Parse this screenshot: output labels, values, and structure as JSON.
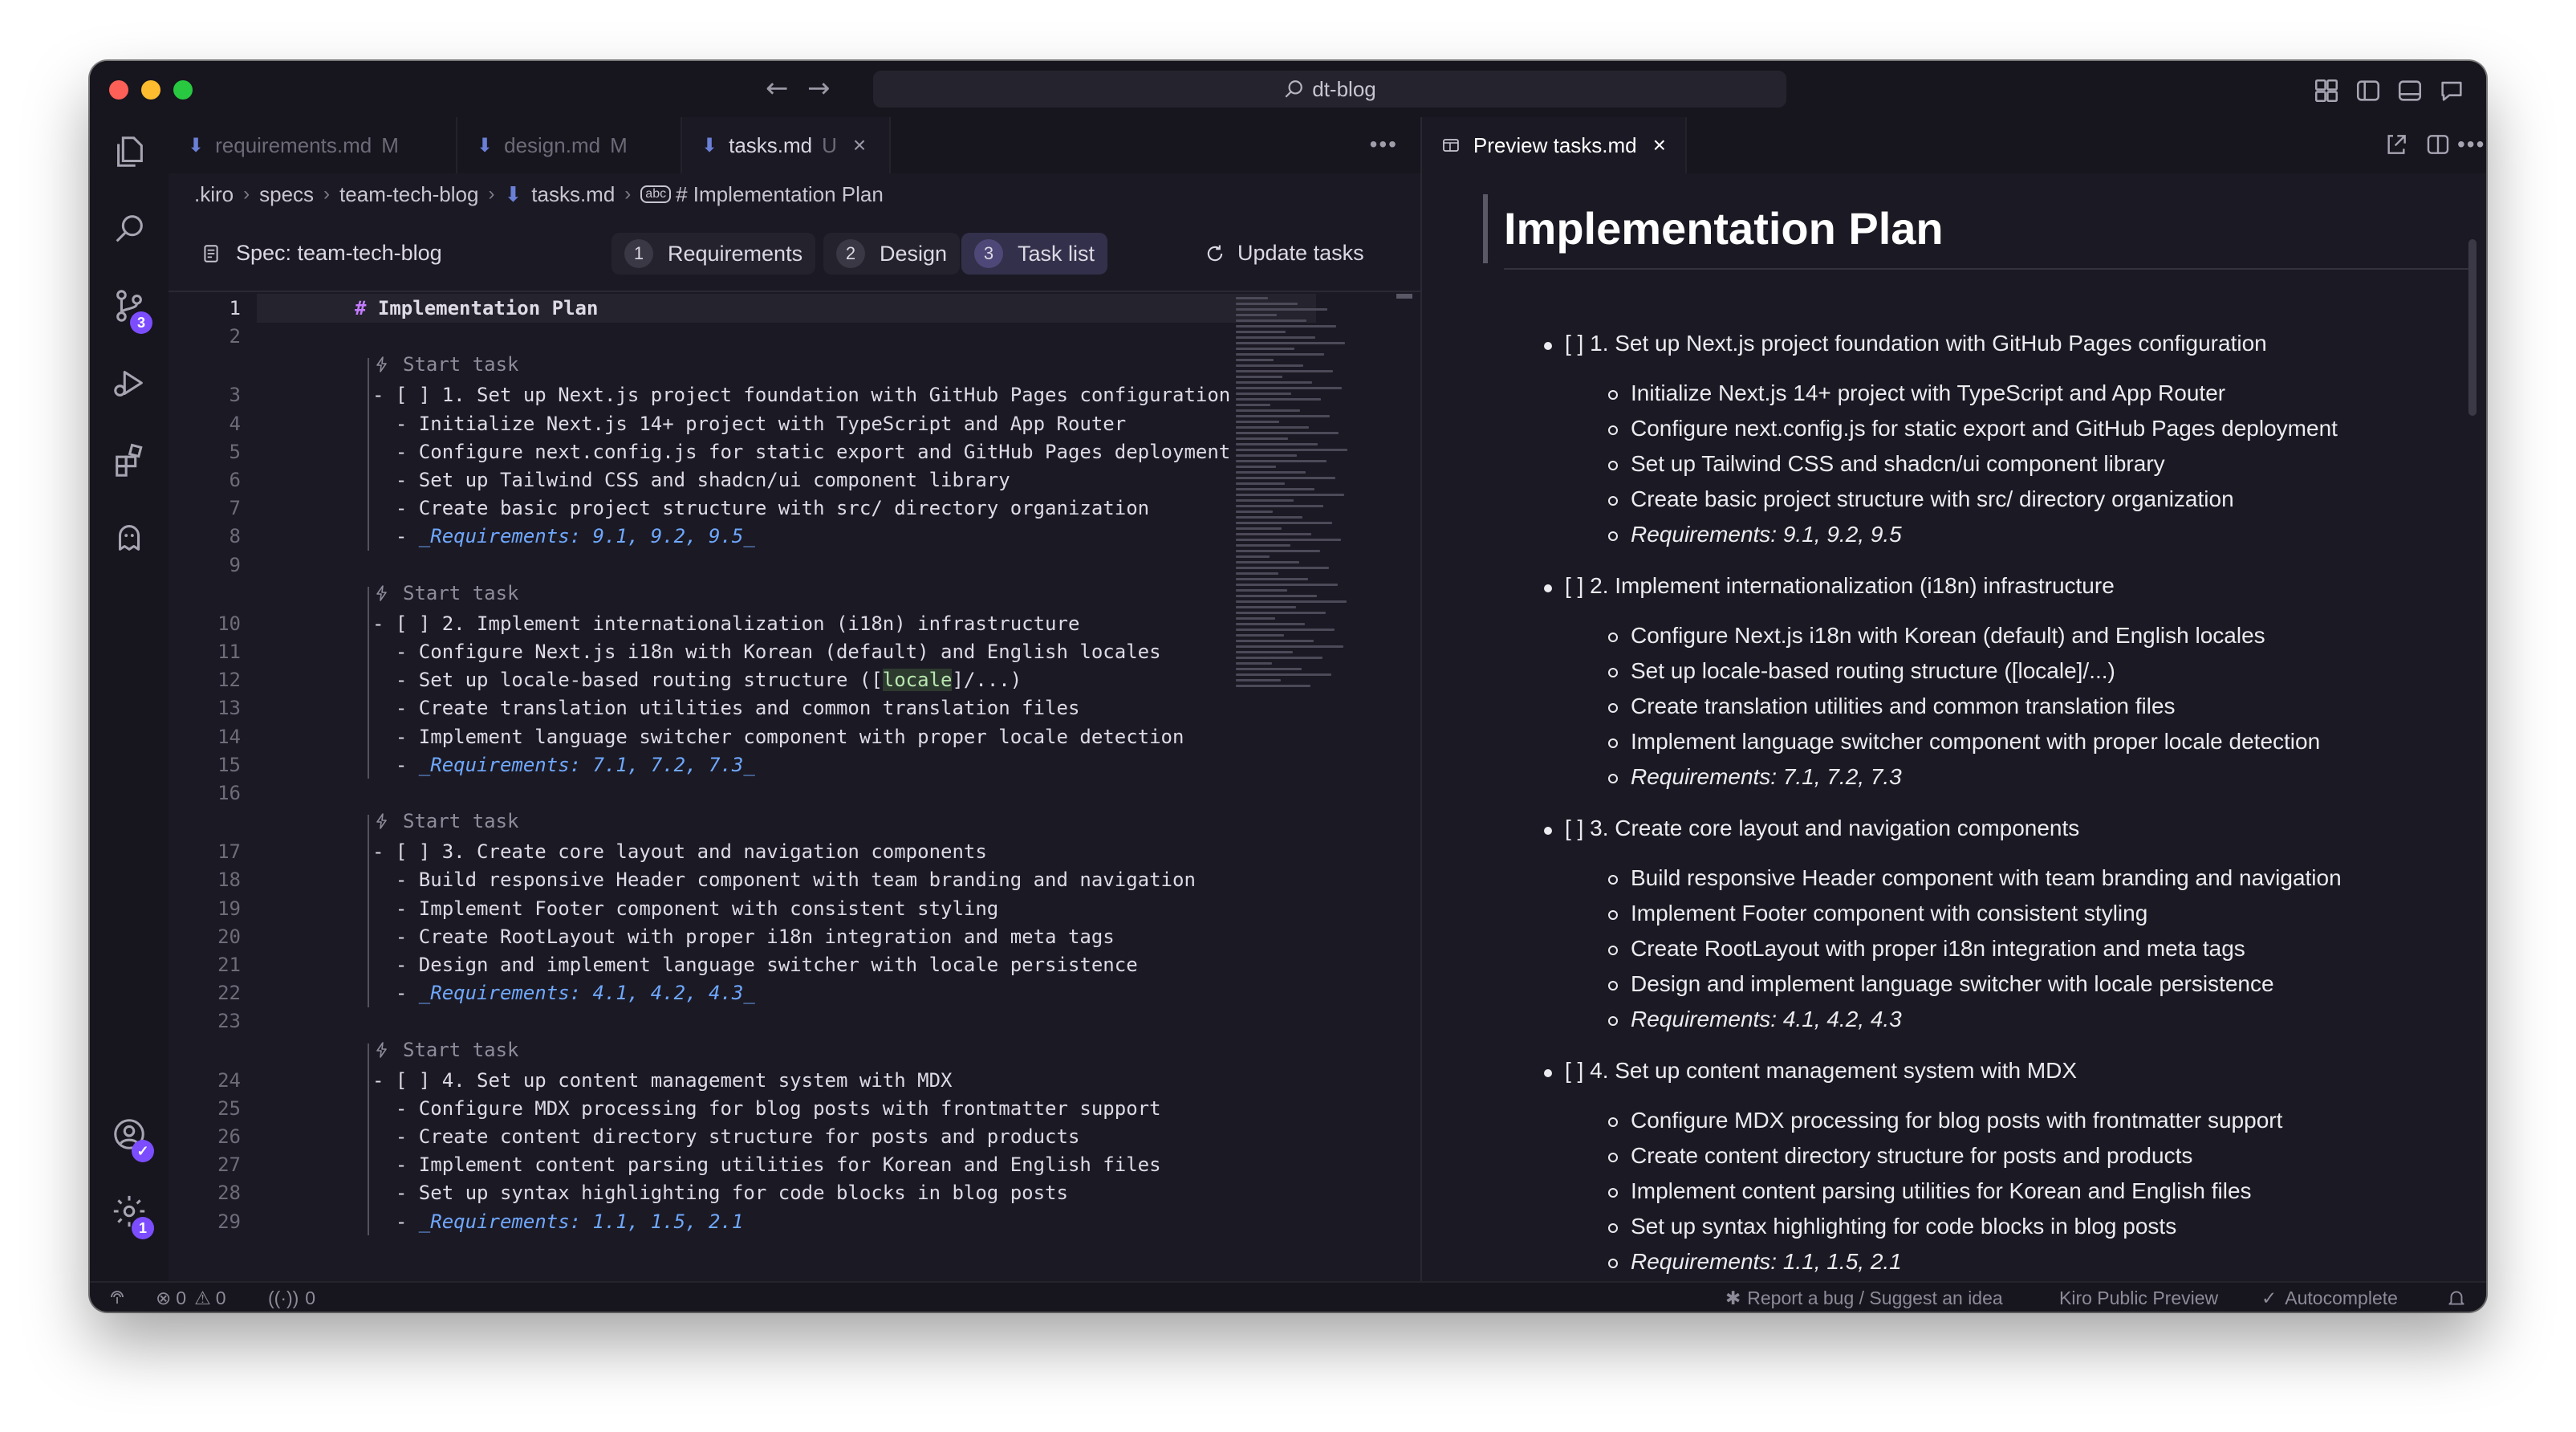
{
  "window": {
    "title": "dt-blog"
  },
  "tabs": [
    {
      "label": "requirements.md",
      "status": "M",
      "active": false
    },
    {
      "label": "design.md",
      "status": "M",
      "active": false
    },
    {
      "label": "tasks.md",
      "status": "U",
      "active": true
    }
  ],
  "breadcrumb": [
    ".kiro",
    "specs",
    "team-tech-blog",
    "tasks.md",
    "# Implementation Plan"
  ],
  "spec": {
    "title": "Spec: team-tech-blog",
    "steps": [
      {
        "num": "1",
        "label": "Requirements"
      },
      {
        "num": "2",
        "label": "Design"
      },
      {
        "num": "3",
        "label": "Task list"
      }
    ],
    "update_label": "Update tasks"
  },
  "editor": {
    "start_task_label": "Start task",
    "lines": [
      {
        "n": "1",
        "text": "Implementation Plan",
        "hash": "#"
      },
      {
        "n": "2",
        "text": ""
      },
      {
        "n": "3",
        "text": "- [ ] 1. Set up Next.js project foundation with GitHub Pages configuration"
      },
      {
        "n": "4",
        "text": "  - Initialize Next.js 14+ project with TypeScript and App Router"
      },
      {
        "n": "5",
        "text": "  - Configure next.config.js for static export and GitHub Pages deployment"
      },
      {
        "n": "6",
        "text": "  - Set up Tailwind CSS and shadcn/ui component library"
      },
      {
        "n": "7",
        "text": "  - Create basic project structure with src/ directory organization"
      },
      {
        "n": "8",
        "text": "_Requirements: 9.1, 9.2, 9.5_"
      },
      {
        "n": "9",
        "text": ""
      },
      {
        "n": "10",
        "text": "- [ ] 2. Implement internationalization (i18n) infrastructure"
      },
      {
        "n": "11",
        "text": "  - Configure Next.js i18n with Korean (default) and English locales"
      },
      {
        "n": "12",
        "text_pre": "  - Set up locale-based routing structure ([",
        "text_mid": "locale",
        "text_post": "]/...)"
      },
      {
        "n": "13",
        "text": "  - Create translation utilities and common translation files"
      },
      {
        "n": "14",
        "text": "  - Implement language switcher component with proper locale detection"
      },
      {
        "n": "15",
        "text": "_Requirements: 7.1, 7.2, 7.3_"
      },
      {
        "n": "16",
        "text": ""
      },
      {
        "n": "17",
        "text": "- [ ] 3. Create core layout and navigation components"
      },
      {
        "n": "18",
        "text": "  - Build responsive Header component with team branding and navigation"
      },
      {
        "n": "19",
        "text": "  - Implement Footer component with consistent styling"
      },
      {
        "n": "20",
        "text": "  - Create RootLayout with proper i18n integration and meta tags"
      },
      {
        "n": "21",
        "text": "  - Design and implement language switcher with locale persistence"
      },
      {
        "n": "22",
        "text": "_Requirements: 4.1, 4.2, 4.3_"
      },
      {
        "n": "23",
        "text": ""
      },
      {
        "n": "24",
        "text": "- [ ] 4. Set up content management system with MDX"
      },
      {
        "n": "25",
        "text": "  - Configure MDX processing for blog posts with frontmatter support"
      },
      {
        "n": "26",
        "text": "  - Create content directory structure for posts and products"
      },
      {
        "n": "27",
        "text": "  - Implement content parsing utilities for Korean and English files"
      },
      {
        "n": "28",
        "text": "  - Set up syntax highlighting for code blocks in blog posts"
      },
      {
        "n": "29",
        "text": "_Requirements: 1.1, 1.5, 2.1"
      }
    ]
  },
  "preview": {
    "tab_label": "Preview tasks.md",
    "title": "Implementation Plan",
    "tasks": [
      {
        "label": "[ ] 1. Set up Next.js project foundation with GitHub Pages configuration",
        "items": [
          "Initialize Next.js 14+ project with TypeScript and App Router",
          "Configure next.config.js for static export and GitHub Pages deployment",
          "Set up Tailwind CSS and shadcn/ui component library",
          "Create basic project structure with src/ directory organization"
        ],
        "req": "Requirements: 9.1, 9.2, 9.5"
      },
      {
        "label": "[ ] 2. Implement internationalization (i18n) infrastructure",
        "items": [
          "Configure Next.js i18n with Korean (default) and English locales",
          "Set up locale-based routing structure ([locale]/...)",
          "Create translation utilities and common translation files",
          "Implement language switcher component with proper locale detection"
        ],
        "req": "Requirements: 7.1, 7.2, 7.3"
      },
      {
        "label": "[ ] 3. Create core layout and navigation components",
        "items": [
          "Build responsive Header component with team branding and navigation",
          "Implement Footer component with consistent styling",
          "Create RootLayout with proper i18n integration and meta tags",
          "Design and implement language switcher with locale persistence"
        ],
        "req": "Requirements: 4.1, 4.2, 4.3"
      },
      {
        "label": "[ ] 4. Set up content management system with MDX",
        "items": [
          "Configure MDX processing for blog posts with frontmatter support",
          "Create content directory structure for posts and products",
          "Implement content parsing utilities for Korean and English files",
          "Set up syntax highlighting for code blocks in blog posts"
        ],
        "req": "Requirements: 1.1, 1.5, 2.1"
      }
    ]
  },
  "activity_badges": {
    "source_control": "3",
    "settings": "1"
  },
  "statusbar": {
    "errors": "0",
    "warnings": "0",
    "ports": "0",
    "report": "Report a bug / Suggest an idea",
    "preview": "Kiro Public Preview",
    "autocomplete": "Autocomplete"
  },
  "colors": {
    "background": "#1b1923",
    "accent": "#7c4dff",
    "requirement_link": "#6fa8ff"
  }
}
